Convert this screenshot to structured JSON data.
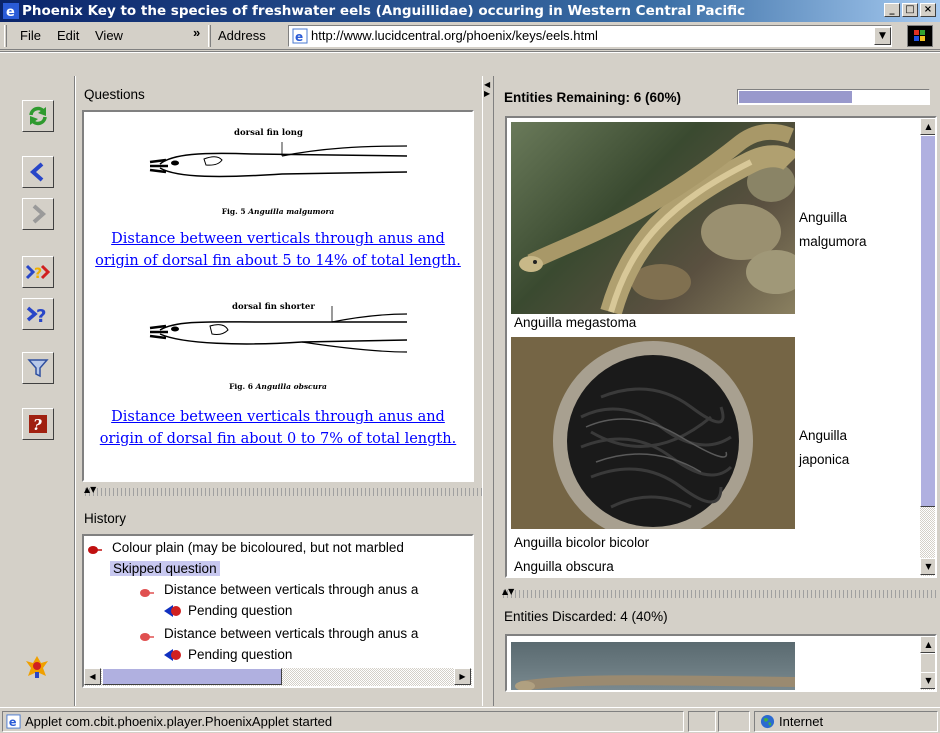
{
  "window": {
    "title": "Phoenix Key to the species of freshwater eels (Anguillidae) occuring in Western Central Pacific",
    "caption_buttons": [
      "minimize",
      "maximize",
      "close"
    ]
  },
  "menu": {
    "items": [
      "File",
      "Edit",
      "View"
    ],
    "overflow": "»",
    "address_label": "Address",
    "address_value": "http://www.lucidcentral.org/phoenix/keys/eels.html"
  },
  "toolbar": {
    "buttons": [
      "refresh-icon",
      "back-icon",
      "forward-icon",
      "best-question-icon",
      "next-question-icon",
      "filter-icon",
      "help-icon"
    ]
  },
  "questions": {
    "label": "Questions",
    "fig5": {
      "annotation": "dorsal fin long",
      "caption_prefix": "Fig. 5",
      "caption_species": "Anguilla malgumora",
      "link": "Distance between verticals through anus and origin of dorsal fin about 5 to 14% of total length.",
      "link_line1": "Distance between verticals through anus and",
      "link_line2": "origin of dorsal fin about 5 to 14% of total length."
    },
    "fig6": {
      "annotation": "dorsal fin shorter",
      "caption_prefix": "Fig. 6",
      "caption_species": "Anguilla obscura",
      "link": "Distance between verticals through anus and origin of dorsal fin about 0 to 7% of total length.",
      "link_line1": "Distance between verticals through anus and",
      "link_line2": "origin of dorsal fin about 0 to 7% of total length."
    }
  },
  "history": {
    "label": "History",
    "items": [
      {
        "text": "Colour plain (may be bicoloured, but not marbled",
        "status": "Skipped question"
      },
      {
        "text": "Distance between verticals through anus a",
        "status": "Pending question"
      },
      {
        "text": "Distance between verticals through anus a",
        "status": "Pending question"
      }
    ]
  },
  "remaining": {
    "label": "Entities Remaining: 6 (60%)",
    "progress_fraction": 0.6,
    "entities": [
      {
        "name": "Anguilla malgumora",
        "line1": "Anguilla",
        "line2": "malgumora"
      },
      {
        "name": "Anguilla megastoma"
      },
      {
        "name": "Anguilla japonica",
        "line1": "Anguilla",
        "line2": "japonica"
      },
      {
        "name": "Anguilla bicolor bicolor"
      },
      {
        "name": "Anguilla obscura"
      }
    ]
  },
  "discarded": {
    "label": "Entities Discarded: 4 (40%)"
  },
  "status": {
    "message": "Applet com.cbit.phoenix.player.PhoenixApplet started",
    "zone": "Internet"
  },
  "colors": {
    "titlebar_start": "#0a246a",
    "titlebar_end": "#a6caf0",
    "link": "#0000ff",
    "progress": "#9999cc",
    "skipped_highlight": "#c8c8f0"
  }
}
